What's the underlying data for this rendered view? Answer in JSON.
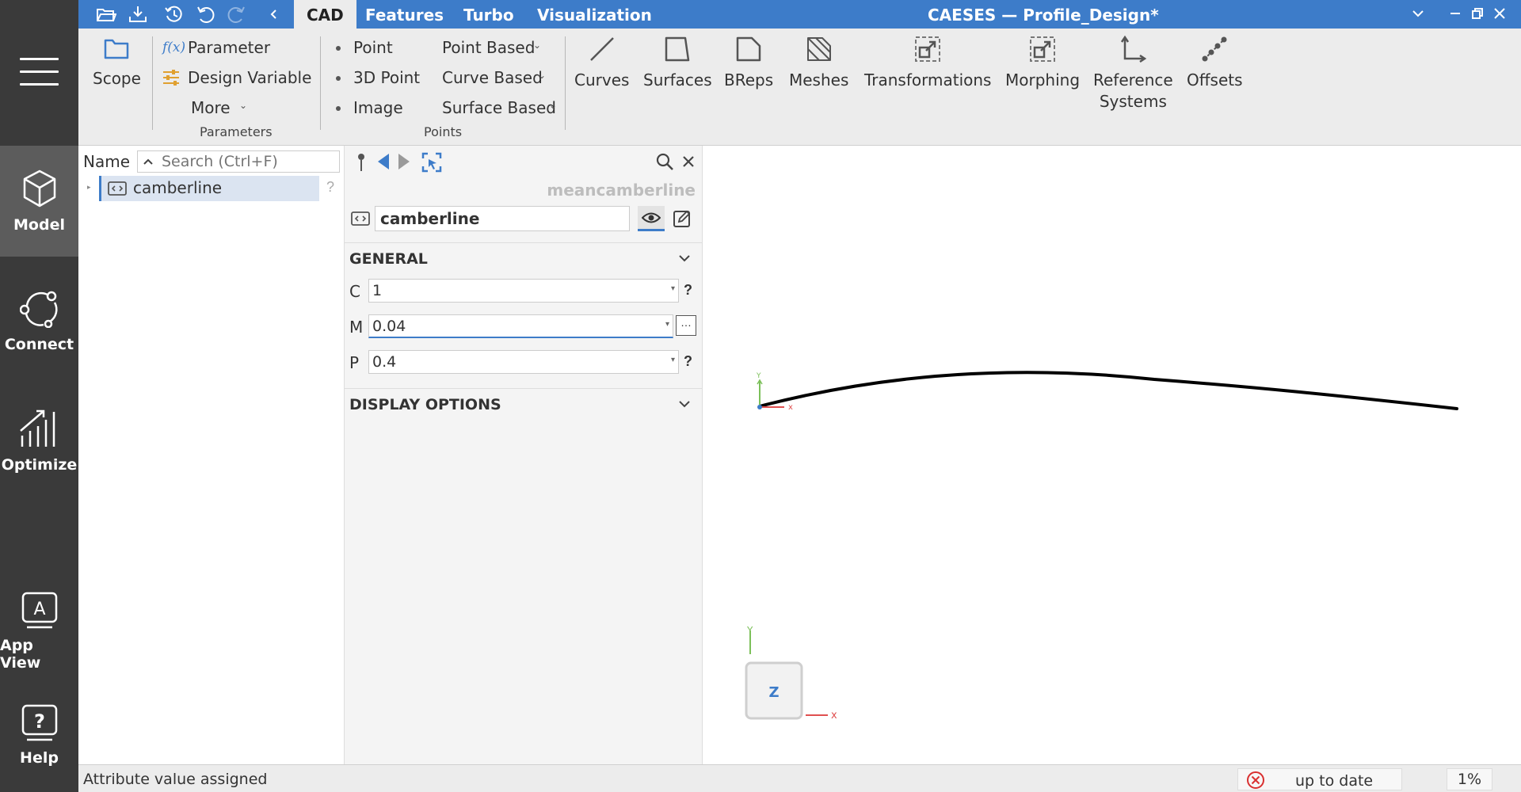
{
  "app": {
    "title": "CAESES — Profile_Design*",
    "accent": "#3d7cc9"
  },
  "sidebar": {
    "items": [
      {
        "label": "Model",
        "icon": "cube-icon"
      },
      {
        "label": "Connect",
        "icon": "connect-icon"
      },
      {
        "label": "Optimize",
        "icon": "optimize-icon"
      },
      {
        "label": "App View",
        "icon": "app-view-icon"
      },
      {
        "label": "Help",
        "icon": "help-icon"
      }
    ]
  },
  "tabs": [
    "CAD",
    "Features",
    "Turbo",
    "Visualization"
  ],
  "ribbon": {
    "scope": "Scope",
    "fx": "f(x)",
    "parameter": "Parameter",
    "design_variable": "Design Variable",
    "more": "More",
    "parameters_group": "Parameters",
    "point": "Point",
    "point_3d": "3D Point",
    "image": "Image",
    "point_based": "Point Based",
    "curve_based": "Curve Based",
    "surface_based": "Surface Based",
    "points_group": "Points",
    "curves": "Curves",
    "surfaces": "Surfaces",
    "breps": "BReps",
    "meshes": "Meshes",
    "transformations": "Transformations",
    "morphing": "Morphing",
    "reference_line1": "Reference",
    "reference_line2": "Systems",
    "offsets": "Offsets"
  },
  "tree": {
    "name_header": "Name",
    "search_placeholder": "Search (Ctrl+F)",
    "items": [
      {
        "label": "camberline"
      }
    ],
    "help": "?"
  },
  "properties": {
    "entity_type": "meancamberline",
    "name": "camberline",
    "general_label": "GENERAL",
    "params": [
      {
        "label": "C",
        "value": "1"
      },
      {
        "label": "M",
        "value": "0.04"
      },
      {
        "label": "P",
        "value": "0.4"
      }
    ],
    "help": "?",
    "display_options_label": "DISPLAY OPTIONS"
  },
  "viewport": {
    "axis_x": "x",
    "axis_y": "Y",
    "axis_z": "Z"
  },
  "status": {
    "message": "Attribute value assigned",
    "state": "up to date",
    "progress": "1%"
  }
}
